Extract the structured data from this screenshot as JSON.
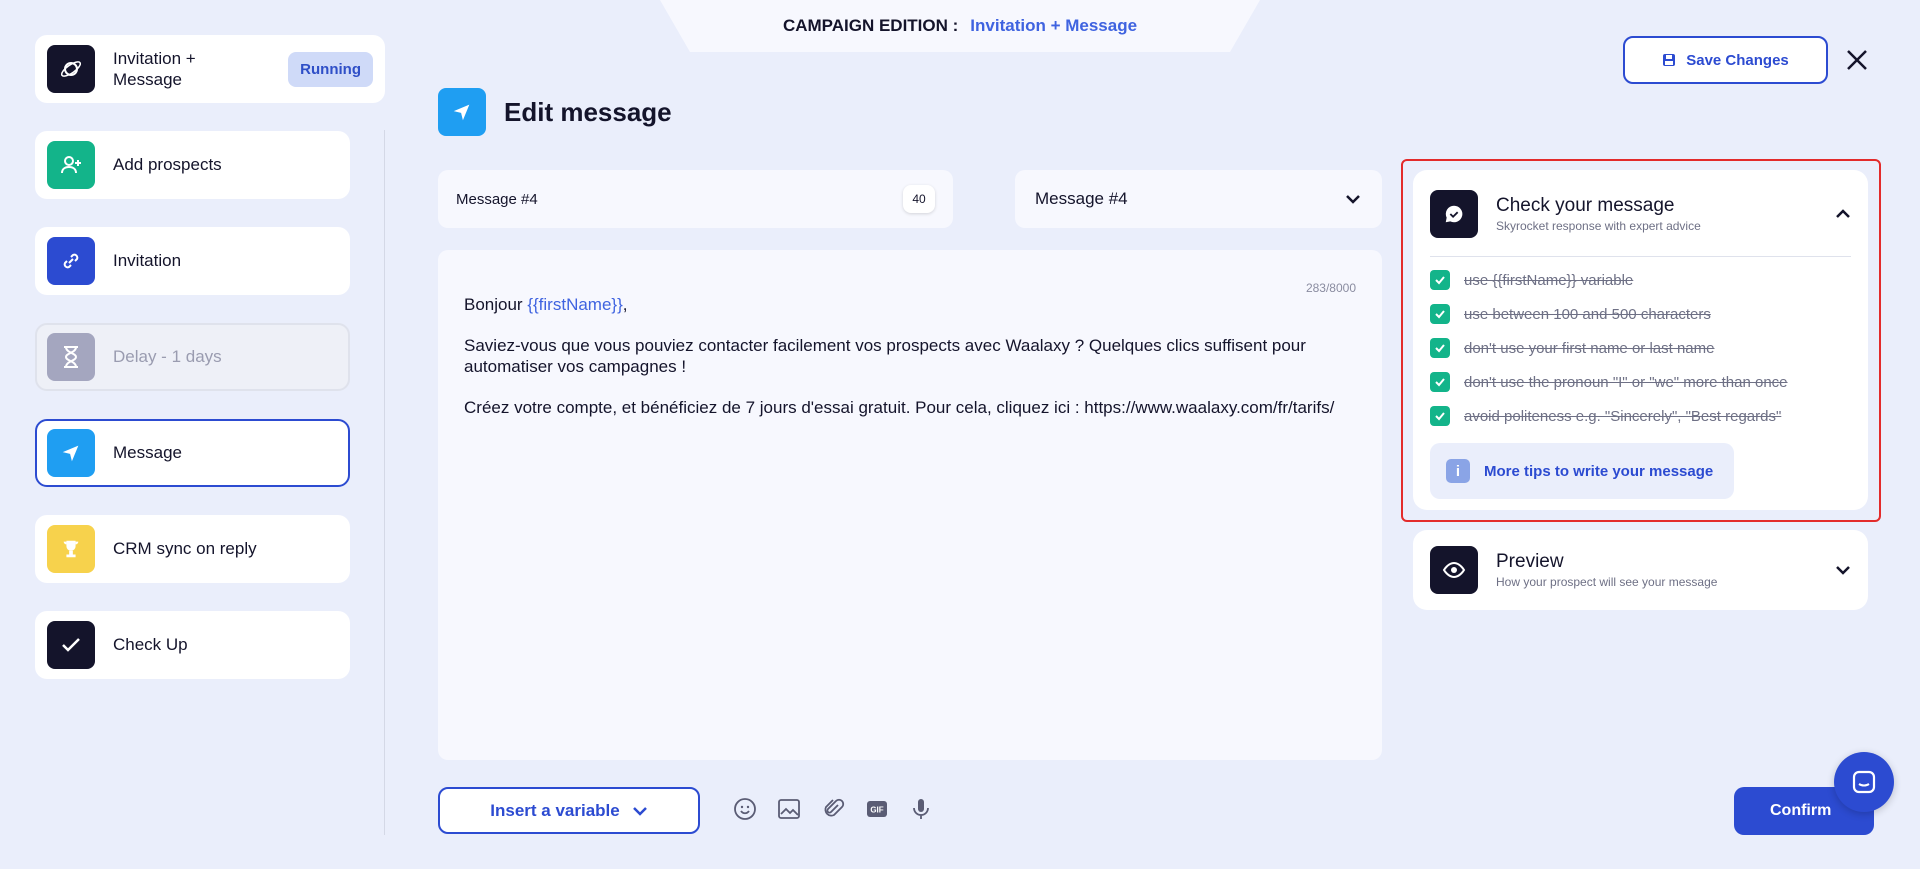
{
  "header": {
    "label": "CAMPAIGN EDITION :",
    "campaign_name": "Invitation + Message"
  },
  "sidebar": {
    "campaign": {
      "title": "Invitation + Message",
      "status": "Running",
      "icon": "planet-icon"
    },
    "steps": [
      {
        "label": "Add prospects",
        "icon": "add-user-icon",
        "color": "#13b48a"
      },
      {
        "label": "Invitation",
        "icon": "link-icon",
        "color": "#2c4bd1"
      },
      {
        "label": "Delay - 1 days",
        "icon": "hourglass-icon",
        "color": "#a4a6bf"
      },
      {
        "label": "Message",
        "icon": "paper-plane-icon",
        "color": "#1f9ef2"
      },
      {
        "label": "CRM sync on reply",
        "icon": "trophy-icon",
        "color": "#f7d24c"
      },
      {
        "label": "Check Up",
        "icon": "check-icon",
        "color": "#14142b"
      }
    ]
  },
  "editor_page": {
    "title": "Edit message",
    "save_label": "Save Changes",
    "name_field": {
      "value": "Message #4",
      "counter": "40"
    },
    "template_select": {
      "value": "Message #4"
    },
    "char_count": "283/8000",
    "message": {
      "greeting": "Bonjour ",
      "greeting_var": "{{firstName}}",
      "greeting_end": ",",
      "para1": "Saviez-vous que vous pouviez contacter facilement vos prospects avec Waalaxy ? Quelques clics suffisent pour automatiser vos campagnes !",
      "para2": "Créez votre compte, et bénéficiez de 7 jours d'essai gratuit. Pour cela, cliquez ici : https://www.waalaxy.com/fr/tarifs/"
    },
    "insert_variable_label": "Insert a variable",
    "confirm_label": "Confirm",
    "toolbar_icons": [
      "emoji-icon",
      "image-icon",
      "attachment-icon",
      "gif-icon",
      "microphone-icon"
    ]
  },
  "check_panel": {
    "title": "Check your message",
    "subtitle": "Skyrocket response with expert advice",
    "items": [
      "use {{firstName}} variable",
      "use between 100 and 500 characters",
      "don't use your first name or last name",
      "don't use the pronoun \"I\" or \"we\" more than once",
      "avoid politeness e.g. \"Sincerely\", \"Best regards\""
    ],
    "tips_label": "More tips to write your message"
  },
  "preview_panel": {
    "title": "Preview",
    "subtitle": "How your prospect will see your message"
  }
}
